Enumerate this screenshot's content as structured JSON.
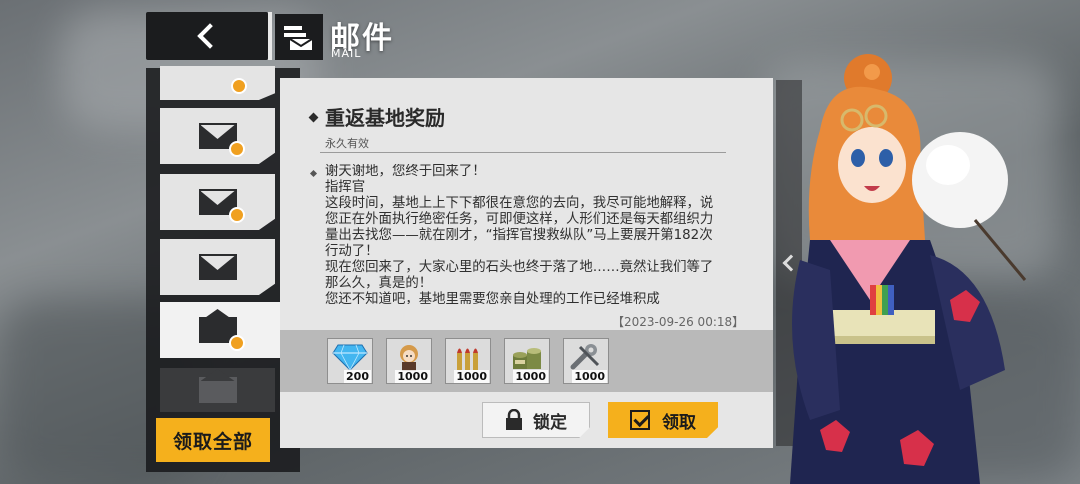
{
  "header": {
    "title": "邮件",
    "subtitle": "MAIL",
    "back_icon": "chevron-left-icon",
    "mail_icon": "mail-stack-icon"
  },
  "sidebar": {
    "items": [
      {
        "state": "read",
        "has_attachment": true
      },
      {
        "state": "unread",
        "has_attachment": true
      },
      {
        "state": "unread",
        "has_attachment": true
      },
      {
        "state": "unread",
        "has_attachment": false
      },
      {
        "state": "selected-open",
        "has_attachment": true
      },
      {
        "state": "disabled-open",
        "has_attachment": false
      }
    ],
    "claim_all_label": "领取全部"
  },
  "mail": {
    "title": "重返基地奖励",
    "validity": "永久有效",
    "body": "谢天谢地，您终于回来了！\n指挥官\n这段时间，基地上上下下都很在意您的去向，我尽可能地解释，说您正在外面执行绝密任务，可即便这样，人形们还是每天都组织力量出去找您——就在刚才，“指挥官搜救纵队”马上要展开第182次行动了！\n现在您回来了，大家心里的石头也终于落了地……竟然让我们等了那么久，真是的！\n您还不知道吧，基地里需要您亲自处理的工作已经堆积成",
    "date": "【2023-09-26 00:18】",
    "rewards": [
      {
        "icon": "diamond-icon",
        "quantity": "200"
      },
      {
        "icon": "doll-chibi-icon",
        "quantity": "1000"
      },
      {
        "icon": "ammo-icon",
        "quantity": "1000"
      },
      {
        "icon": "ration-can-icon",
        "quantity": "1000"
      },
      {
        "icon": "parts-wrench-icon",
        "quantity": "1000"
      }
    ],
    "lock_label": "锁定",
    "claim_label": "领取"
  },
  "colors": {
    "accent": "#f5b01c",
    "panel": "#e6e6e6",
    "dark": "#1b1c1e"
  }
}
